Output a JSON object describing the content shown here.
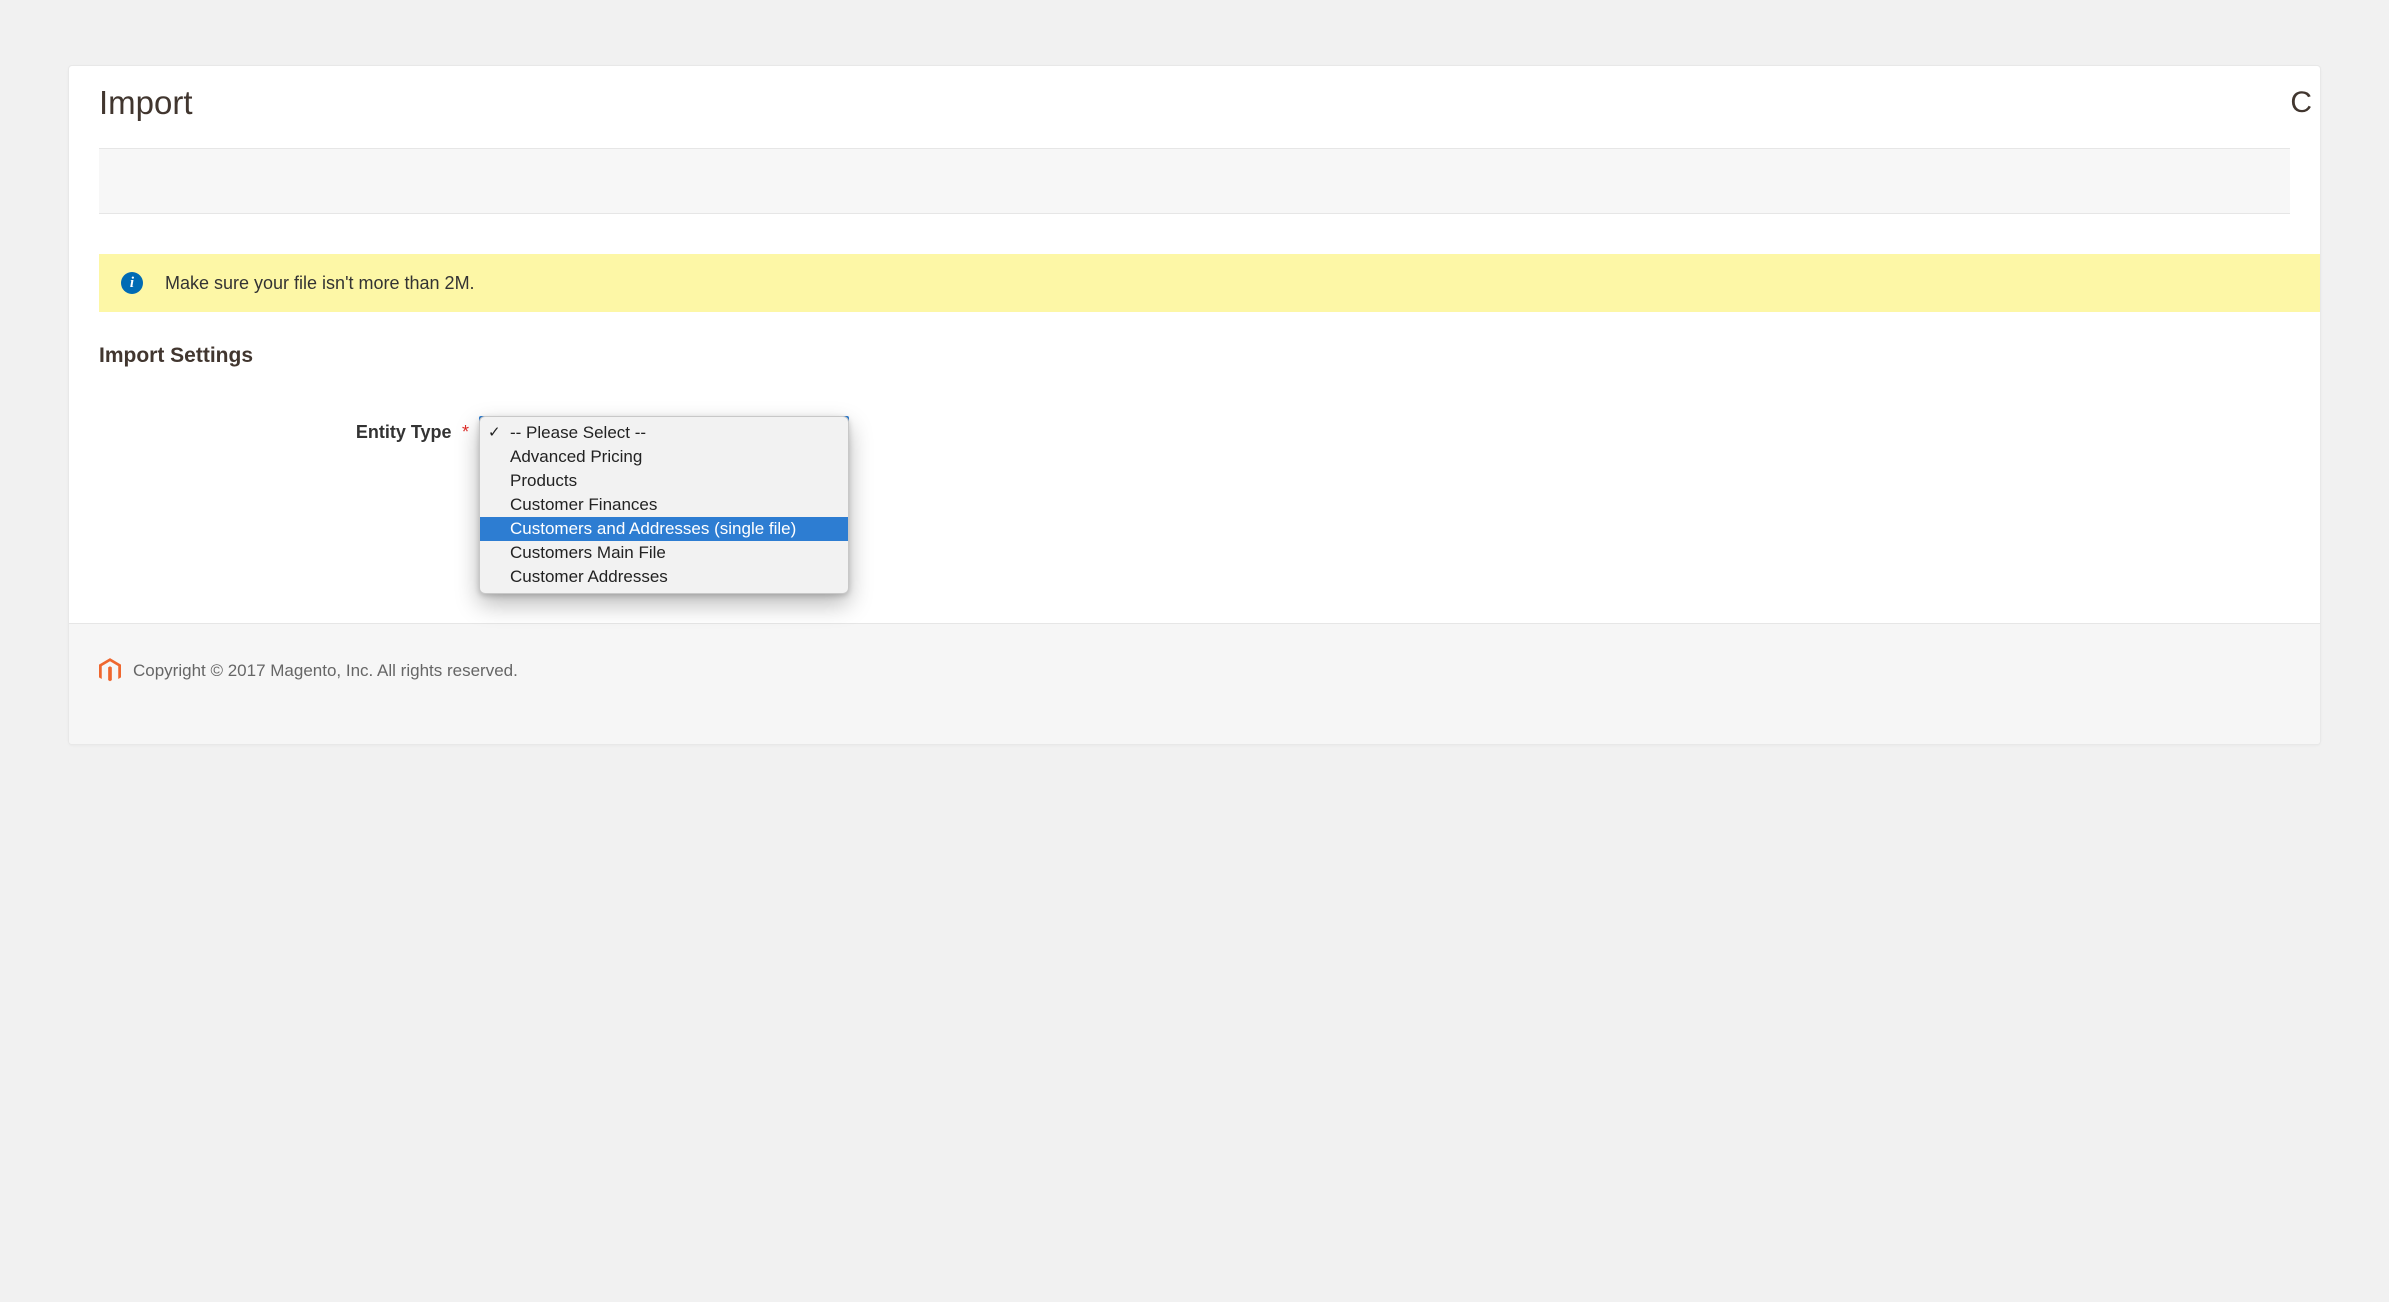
{
  "header": {
    "title": "Import",
    "right_letter": "C"
  },
  "notice": {
    "text": "Make sure your file isn't more than 2M."
  },
  "section": {
    "heading": "Import Settings"
  },
  "form": {
    "entity_type": {
      "label": "Entity Type",
      "required_mark": "*",
      "selected_index": 0,
      "highlight_index": 4,
      "options": [
        "-- Please Select --",
        "Advanced Pricing",
        "Products",
        "Customer Finances",
        "Customers and Addresses (single file)",
        "Customers Main File",
        "Customer Addresses"
      ]
    }
  },
  "footer": {
    "copyright": "Copyright © 2017 Magento, Inc. All rights reserved."
  }
}
